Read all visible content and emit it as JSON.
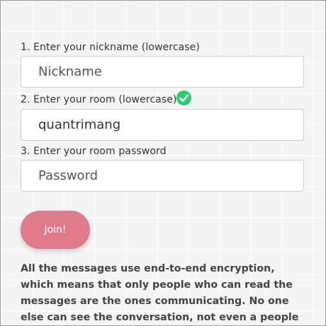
{
  "form": {
    "nickname_label": "1. Enter your nickname (lowercase)",
    "nickname_placeholder": "Nickname",
    "nickname_value": "",
    "room_label": "2. Enter your room (lowercase)",
    "room_value": "quantrimang",
    "room_valid_icon": "check-circle-icon",
    "room_valid_color": "#2ecc71",
    "password_label": "3. Enter your room password",
    "password_placeholder": "Password",
    "password_value": "",
    "join_label": "Join!",
    "join_color": "#e07b8c"
  },
  "note": "All the messages use end-to-end encryption, which means that only people who can read the messages are the ones communicating. No one else can see the conversation, not even a people with access to the"
}
